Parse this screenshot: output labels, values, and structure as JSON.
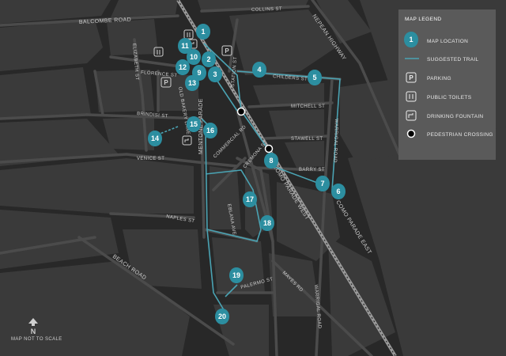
{
  "map": {
    "colors": {
      "background": "#282828",
      "block": "#3a3a3a",
      "trail": "#4aa3b3",
      "marker": "#2c8ea0",
      "legend_bg": "#5a5a5a"
    },
    "streets": [
      {
        "id": "balcombe",
        "label": "BALCOMBE ROAD"
      },
      {
        "id": "collins",
        "label": "COLLINS ST"
      },
      {
        "id": "nepean",
        "label": "NEPEAN HIGHWAY"
      },
      {
        "id": "elizabeth",
        "label": "ELIZABETH ST"
      },
      {
        "id": "florence",
        "label": "FLORENCE ST"
      },
      {
        "id": "station",
        "label": "STATION ST"
      },
      {
        "id": "childers",
        "label": "CHILDERS ST"
      },
      {
        "id": "mitchell",
        "label": "MITCHELL ST"
      },
      {
        "id": "brindisi",
        "label": "BRINDISI ST"
      },
      {
        "id": "oldbakery",
        "label": "OLD BAKERY LANE"
      },
      {
        "id": "mentone",
        "label": "MENTONE PARADE"
      },
      {
        "id": "stawell",
        "label": "STAWELL ST"
      },
      {
        "id": "warrigal_top",
        "label": "WARRIGAL ROAD"
      },
      {
        "id": "commercial",
        "label": "COMMERCIAL RD"
      },
      {
        "id": "venice",
        "label": "VENICE ST"
      },
      {
        "id": "barry",
        "label": "BARRY ST"
      },
      {
        "id": "cremona",
        "label": "CREMONA ST"
      },
      {
        "id": "como_west",
        "label": "COMO PARADE WEST"
      },
      {
        "id": "como_east",
        "label": "COMO PARADE EAST"
      },
      {
        "id": "eblana",
        "label": "EBLANA AVE"
      },
      {
        "id": "naples",
        "label": "NAPLES ST"
      },
      {
        "id": "beach",
        "label": "BEACH ROAD"
      },
      {
        "id": "palermo",
        "label": "PALERMO ST"
      },
      {
        "id": "mayes",
        "label": "MAYES RD"
      },
      {
        "id": "warrigal_bottom",
        "label": "WARRIGAL ROAD"
      }
    ],
    "markers": [
      "1",
      "2",
      "3",
      "4",
      "5",
      "6",
      "7",
      "8",
      "9",
      "10",
      "11",
      "12",
      "13",
      "14",
      "15",
      "16",
      "17",
      "18",
      "19",
      "20"
    ],
    "legend": {
      "title": "MAP LEGEND",
      "items": [
        {
          "icon": "map-marker-icon",
          "label": "MAP LOCATION"
        },
        {
          "icon": "trail-line-icon",
          "label": "SUGGESTED TRAIL"
        },
        {
          "icon": "parking-icon",
          "label": "PARKING"
        },
        {
          "icon": "toilets-icon",
          "label": "PUBLIC TOILETS"
        },
        {
          "icon": "drinking-fountain-icon",
          "label": "DRINKING FOUNTAIN"
        },
        {
          "icon": "pedestrian-crossing-icon",
          "label": "PEDESTRIAN CROSSING"
        }
      ]
    },
    "north_symbol": "N",
    "scale_note": "MAP NOT TO SCALE",
    "parking_symbol": "P"
  }
}
